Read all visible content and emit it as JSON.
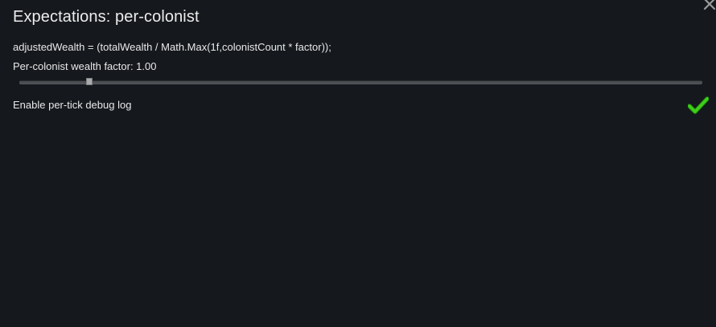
{
  "window": {
    "title": "Expectations: per-colonist",
    "close_icon": "close-icon"
  },
  "settings": {
    "formula": "adjustedWealth = (totalWealth / Math.Max(1f,colonistCount * factor));",
    "factor_label": "Per-colonist wealth factor: 1.00",
    "factor_slider_level": 0.1,
    "debug_label": "Enable per-tick debug log",
    "debug_checked": true,
    "check_icon": "checkmark-icon",
    "check_color": "#3fcf1a"
  }
}
